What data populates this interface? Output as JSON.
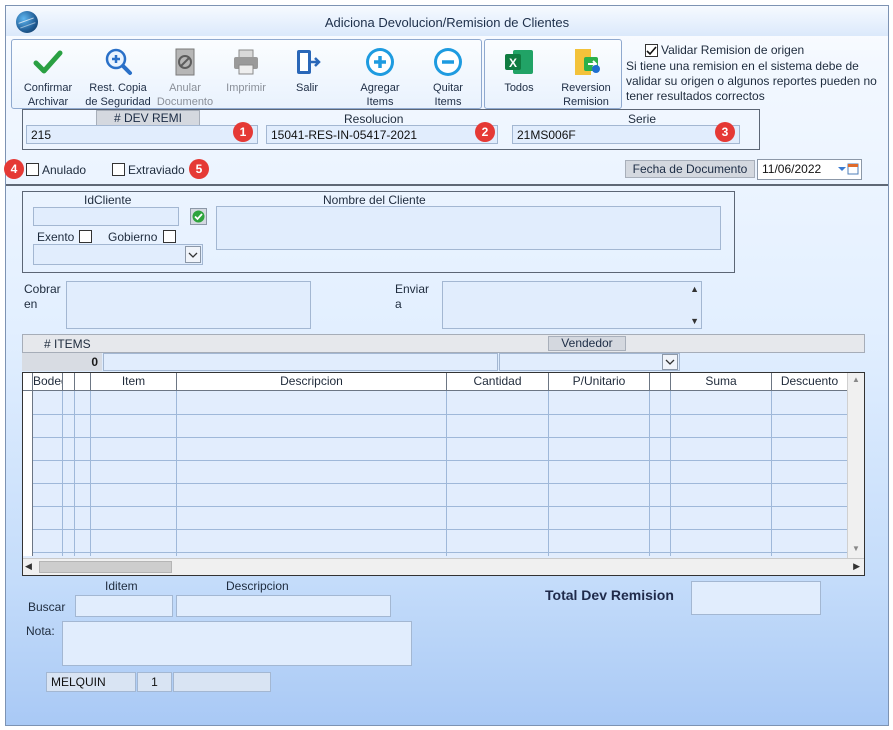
{
  "window": {
    "title": "Adiciona Devolucion/Remision de Clientes"
  },
  "toolbar": {
    "confirm": "Confirmar\nArchivar",
    "restore": "Rest. Copia\nde Seguridad",
    "void": "Anular\nDocumento",
    "print": "Imprimir",
    "exit": "Salir",
    "add_items": "Agregar\nItems",
    "remove_items": "Quitar\nItems",
    "all": "Todos",
    "reversal": "Reversion\nRemision"
  },
  "validate": {
    "label": "Validar Remision de origen",
    "checked": true,
    "note": "Si tiene una remision en el sistema debe de validar su origen o algunos reportes pueden no tener resultados correctos"
  },
  "header": {
    "dev_remi_label": "# DEV REMI",
    "dev_remi_value": "215",
    "resolucion_label": "Resolucion",
    "resolucion_value": "15041-RES-IN-05417-2021",
    "serie_label": "Serie",
    "serie_value": "21MS006F",
    "badges": [
      "1",
      "2",
      "3",
      "4",
      "5"
    ]
  },
  "flags": {
    "anulado": "Anulado",
    "extraviado": "Extraviado"
  },
  "fecha": {
    "label": "Fecha de  Documento",
    "value": "11/06/2022"
  },
  "cliente": {
    "id_label": "IdCliente",
    "id_value": "",
    "name_label": "Nombre del Cliente",
    "name_value": "",
    "exento": "Exento",
    "gobierno": "Gobierno"
  },
  "addresses": {
    "cobrar": "Cobrar\nen",
    "enviar": "Enviar\na"
  },
  "items_bar": {
    "items_label": "# ITEMS",
    "items_count": "0",
    "vendedor_label": "Vendedor"
  },
  "grid": {
    "columns": [
      "Bodega",
      "",
      "",
      "Item",
      "Descripcion",
      "Cantidad",
      "P/Unitario",
      "",
      "Suma",
      "Descuento"
    ],
    "rows": 8
  },
  "footer": {
    "iditem_label": "Iditem",
    "descripcion_label": "Descripcion",
    "buscar_label": "Buscar",
    "nota_label": "Nota:",
    "total_label": "Total Dev Remision",
    "total_value": "",
    "user": "MELQUIN",
    "station": "1",
    "extra": ""
  },
  "colors": {
    "accent": "#1f2a4a",
    "badge": "#e53935",
    "field": "#e1edfd"
  }
}
